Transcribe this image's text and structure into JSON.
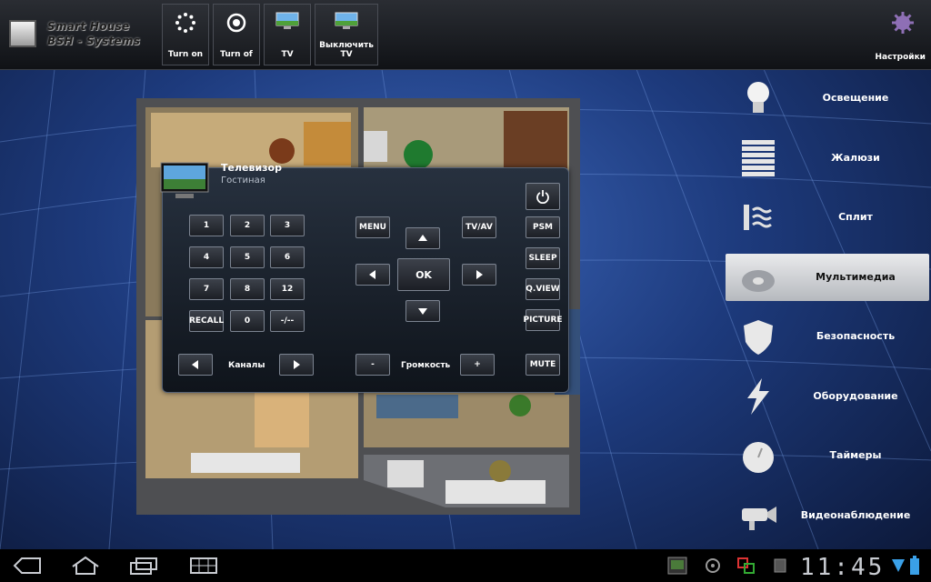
{
  "app": {
    "logo_line1": "Smart House",
    "logo_line2": "BSH - Systems",
    "settings_label": "Настройки"
  },
  "toolbar": [
    {
      "label": "Turn on",
      "icon": "light-burst-icon"
    },
    {
      "label": "Turn of",
      "icon": "target-icon"
    },
    {
      "label": "TV",
      "icon": "tv-icon"
    },
    {
      "label": "Выключить TV",
      "icon": "tv-icon"
    }
  ],
  "remote": {
    "device": "Телевизор",
    "room": "Гостиная",
    "keys": {
      "k1": "1",
      "k2": "2",
      "k3": "3",
      "k4": "4",
      "k5": "5",
      "k6": "6",
      "k7": "7",
      "k8": "8",
      "k12": "12",
      "recall": "RECALL",
      "k0": "0",
      "dash": "-/--",
      "menu": "MENU",
      "tvav": "TV/AV",
      "ok": "OK",
      "psm": "PSM",
      "sleep": "SLEEP",
      "qview": "Q.VIEW",
      "picture": "PICTURE",
      "mute": "MUTE",
      "vol_minus": "-",
      "vol_plus": "+"
    },
    "channels_label": "Каналы",
    "volume_label": "Громкость"
  },
  "menu": [
    {
      "label": "Освещение",
      "icon": "bulb-icon"
    },
    {
      "label": "Жалюзи",
      "icon": "blinds-icon"
    },
    {
      "label": "Сплит",
      "icon": "heat-waves-icon"
    },
    {
      "label": "Мультимедиа",
      "icon": "media-disc-icon",
      "active": true
    },
    {
      "label": "Безопасность",
      "icon": "shield-icon"
    },
    {
      "label": "Оборудование",
      "icon": "lightning-icon"
    },
    {
      "label": "Таймеры",
      "icon": "clock-icon"
    },
    {
      "label": "Видеонаблюдение",
      "icon": "camera-icon"
    }
  ],
  "system": {
    "clock": "11:45"
  },
  "colors": {
    "accent": "#2d55a8",
    "active_item": "#e9eaec"
  }
}
